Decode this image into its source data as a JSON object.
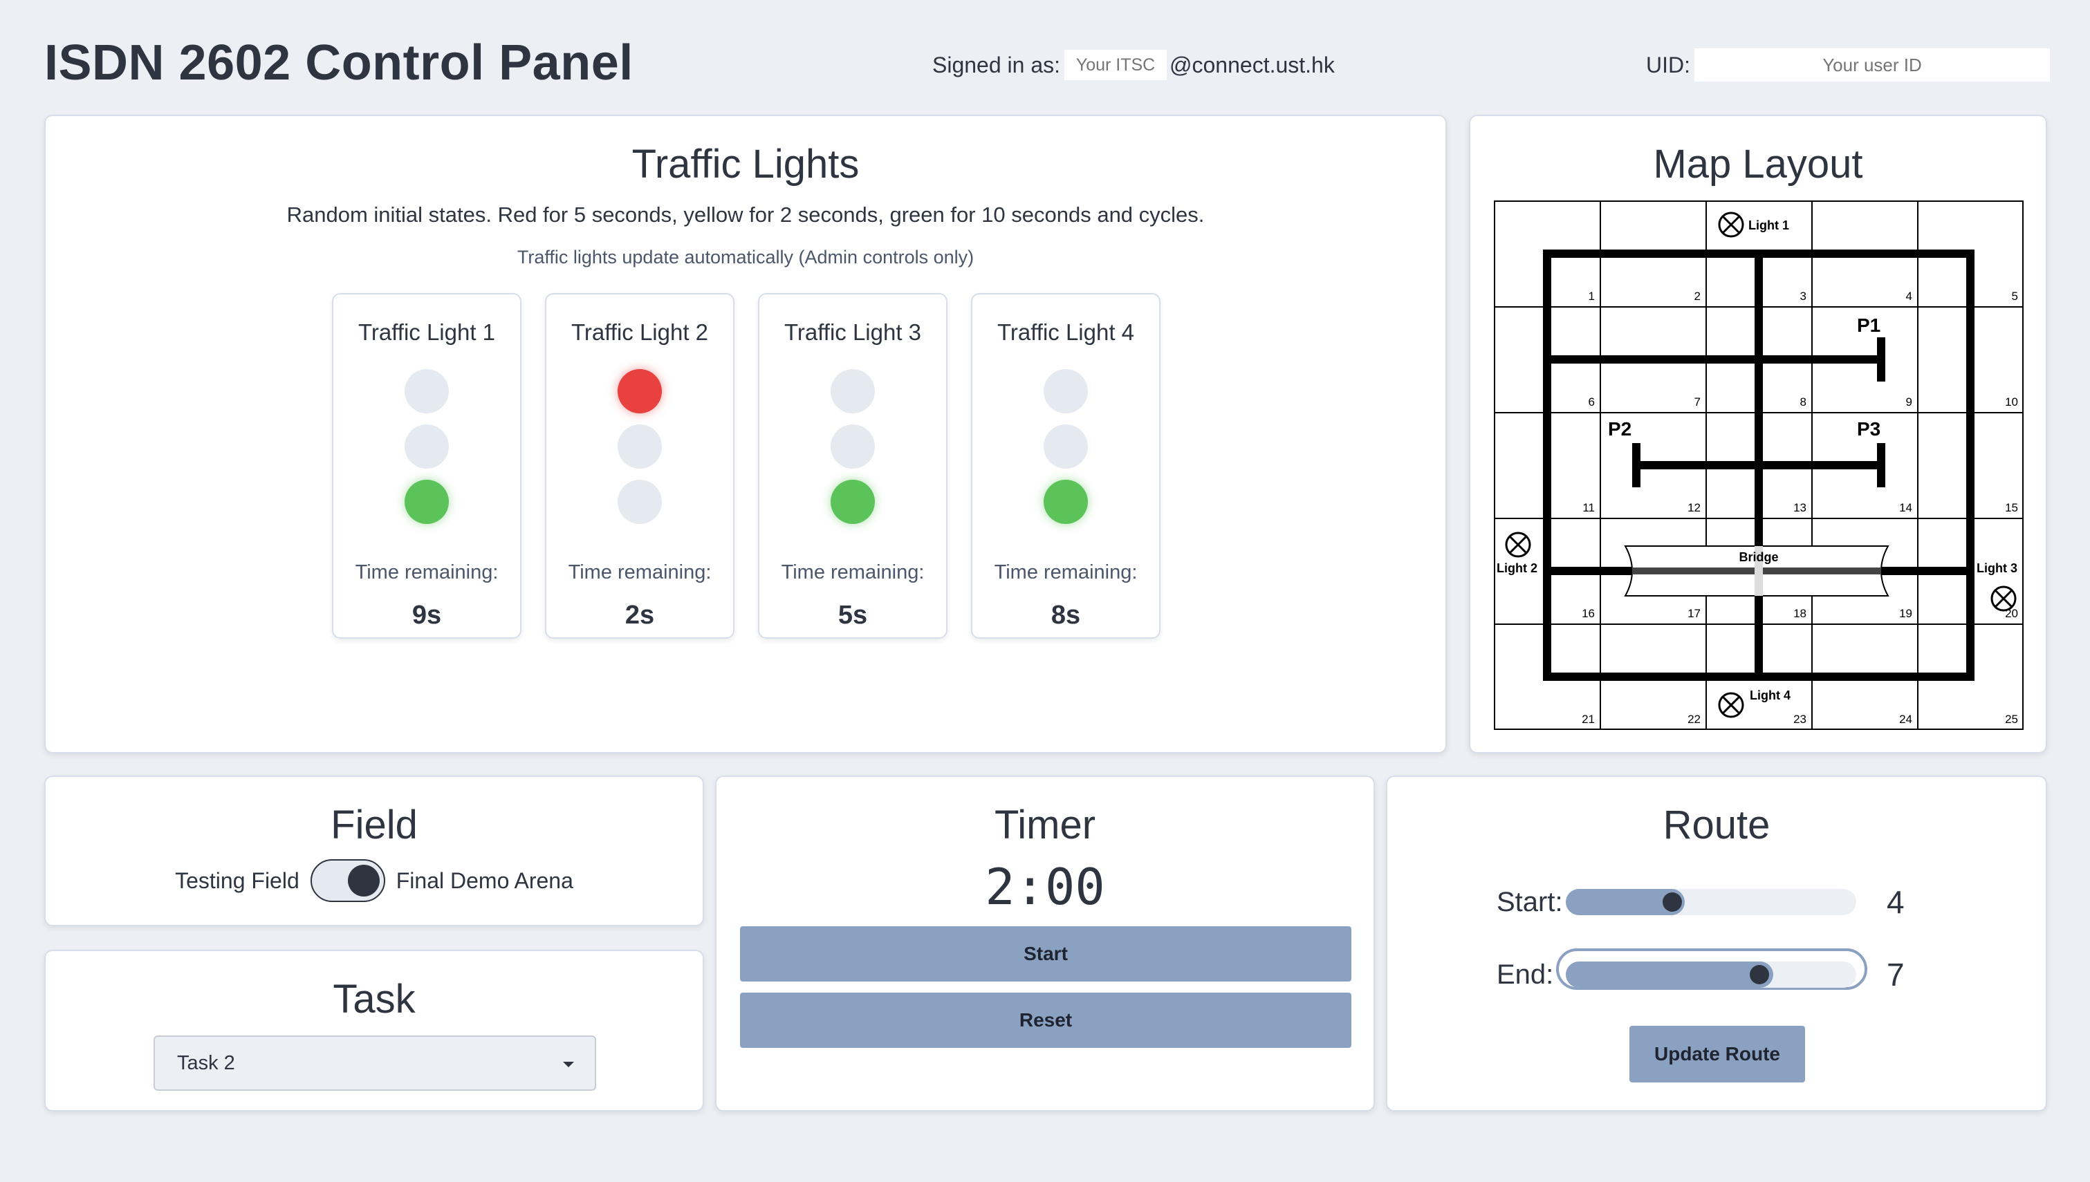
{
  "header": {
    "title": "ISDN 2602 Control Panel",
    "signed_in_label": "Signed in as:",
    "itsc_placeholder": "Your ITSC",
    "domain": "@connect.ust.hk",
    "uid_label": "UID:",
    "uid_placeholder": "Your user ID"
  },
  "traffic": {
    "title": "Traffic Lights",
    "description": "Random initial states. Red for 5 seconds, yellow for 2 seconds, green for 10 seconds and cycles.",
    "note": "Traffic lights update automatically (Admin controls only)",
    "time_label": "Time remaining:",
    "lights": [
      {
        "name": "Traffic Light 1",
        "state": "green",
        "time": "9s"
      },
      {
        "name": "Traffic Light 2",
        "state": "red",
        "time": "2s"
      },
      {
        "name": "Traffic Light 3",
        "state": "green",
        "time": "5s"
      },
      {
        "name": "Traffic Light 4",
        "state": "green",
        "time": "8s"
      }
    ],
    "colors": {
      "red": "#e8413f",
      "green": "#5cc35a",
      "off": "#e5e9f0"
    }
  },
  "map": {
    "title": "Map Layout",
    "cells": [
      "1",
      "2",
      "3",
      "4",
      "5",
      "6",
      "7",
      "8",
      "9",
      "10",
      "11",
      "12",
      "13",
      "14",
      "15",
      "16",
      "17",
      "18",
      "19",
      "20",
      "21",
      "22",
      "23",
      "24",
      "25"
    ],
    "labels": {
      "light1": "Light 1",
      "light2": "Light 2",
      "light3": "Light 3",
      "light4": "Light 4",
      "p1": "P1",
      "p2": "P2",
      "p3": "P3",
      "bridge": "Bridge"
    }
  },
  "field": {
    "title": "Field",
    "left_label": "Testing Field",
    "right_label": "Final Demo Arena",
    "toggle_on": true
  },
  "task": {
    "title": "Task",
    "selected": "Task 2"
  },
  "timer": {
    "title": "Timer",
    "display": "2:00",
    "start_label": "Start",
    "reset_label": "Reset"
  },
  "route": {
    "title": "Route",
    "start_label": "Start:",
    "start_value": "4",
    "end_label": "End:",
    "end_value": "7",
    "update_label": "Update Route"
  },
  "theme": {
    "accent": "#8aa1c1",
    "text": "#2e3440",
    "background": "#eceff4"
  }
}
